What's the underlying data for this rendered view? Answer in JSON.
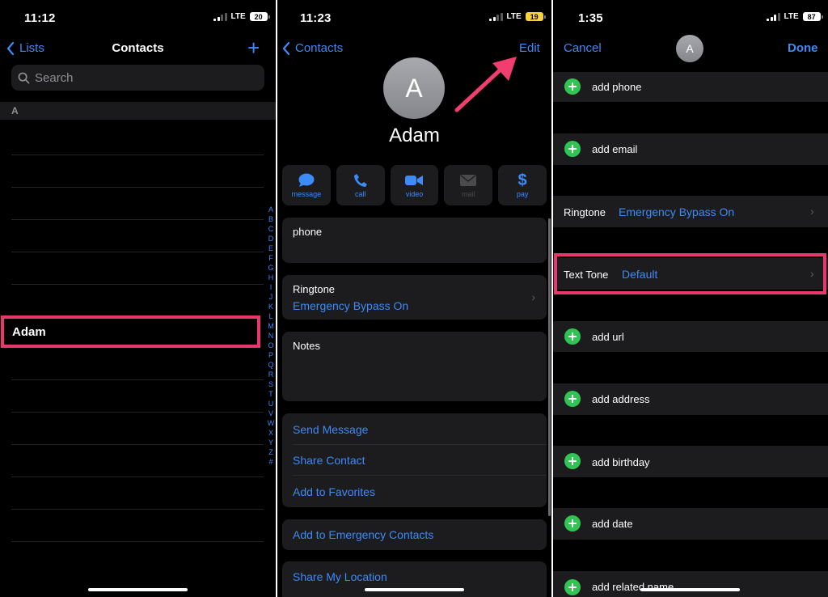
{
  "panel1": {
    "status": {
      "time": "11:12",
      "network": "LTE",
      "battery": "20"
    },
    "nav": {
      "back": "Lists",
      "title": "Contacts",
      "add": "+"
    },
    "search_placeholder": "Search",
    "section": "A",
    "highlighted_contact": "Adam",
    "alphabet": [
      "A",
      "B",
      "C",
      "D",
      "E",
      "F",
      "G",
      "H",
      "I",
      "J",
      "K",
      "L",
      "M",
      "N",
      "O",
      "P",
      "Q",
      "R",
      "S",
      "T",
      "U",
      "V",
      "W",
      "X",
      "Y",
      "Z",
      "#"
    ]
  },
  "panel2": {
    "status": {
      "time": "11:23",
      "network": "LTE",
      "battery": "19"
    },
    "nav": {
      "back": "Contacts",
      "edit": "Edit"
    },
    "avatar_initial": "A",
    "name": "Adam",
    "actions": [
      {
        "label": "message",
        "icon": "message-bubble-icon",
        "enabled": true
      },
      {
        "label": "call",
        "icon": "phone-icon",
        "enabled": true
      },
      {
        "label": "video",
        "icon": "video-camera-icon",
        "enabled": true
      },
      {
        "label": "mail",
        "icon": "envelope-icon",
        "enabled": false
      },
      {
        "label": "pay",
        "icon": "dollar-icon",
        "enabled": true
      }
    ],
    "phone_label": "phone",
    "ringtone_label": "Ringtone",
    "ringtone_value": "Emergency Bypass On",
    "notes_label": "Notes",
    "links": [
      "Send Message",
      "Share Contact",
      "Add to Favorites"
    ],
    "emergency": "Add to Emergency Contacts",
    "location": "Share My Location"
  },
  "panel3": {
    "status": {
      "time": "1:35",
      "network": "LTE",
      "battery": "87"
    },
    "nav": {
      "cancel": "Cancel",
      "done": "Done"
    },
    "avatar_initial": "A",
    "add_phone": "add phone",
    "add_email": "add email",
    "ringtone_label": "Ringtone",
    "ringtone_value": "Emergency Bypass On",
    "text_tone_label": "Text Tone",
    "text_tone_value": "Default",
    "add_url": "add url",
    "add_address": "add address",
    "add_birthday": "add birthday",
    "add_date": "add date",
    "add_related": "add related name"
  },
  "colors": {
    "accent": "#3e8af7",
    "highlight": "#e7386d",
    "add_green": "#30c552",
    "arrow": "#f23d6f"
  }
}
